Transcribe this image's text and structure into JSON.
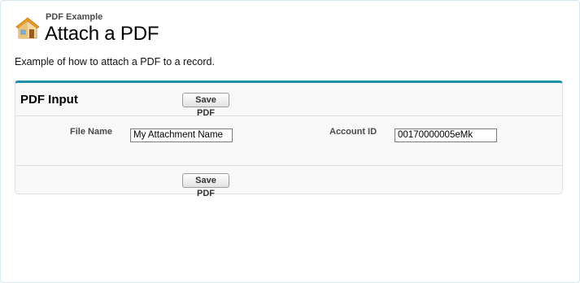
{
  "page": {
    "subtitle": "PDF Example",
    "title": "Attach a PDF",
    "icon": "home-icon",
    "description": "Example of how to attach a PDF to a record."
  },
  "block": {
    "title": "PDF Input",
    "save_button_top": "Save PDF",
    "save_button_bottom": "Save PDF",
    "fields": {
      "file_name": {
        "label": "File Name",
        "value": "My Attachment Name"
      },
      "account_id": {
        "label": "Account ID",
        "value": "00170000005eMk"
      }
    }
  },
  "colors": {
    "accent_border": "#1f8db0",
    "block_background": "#f8f8f8"
  }
}
